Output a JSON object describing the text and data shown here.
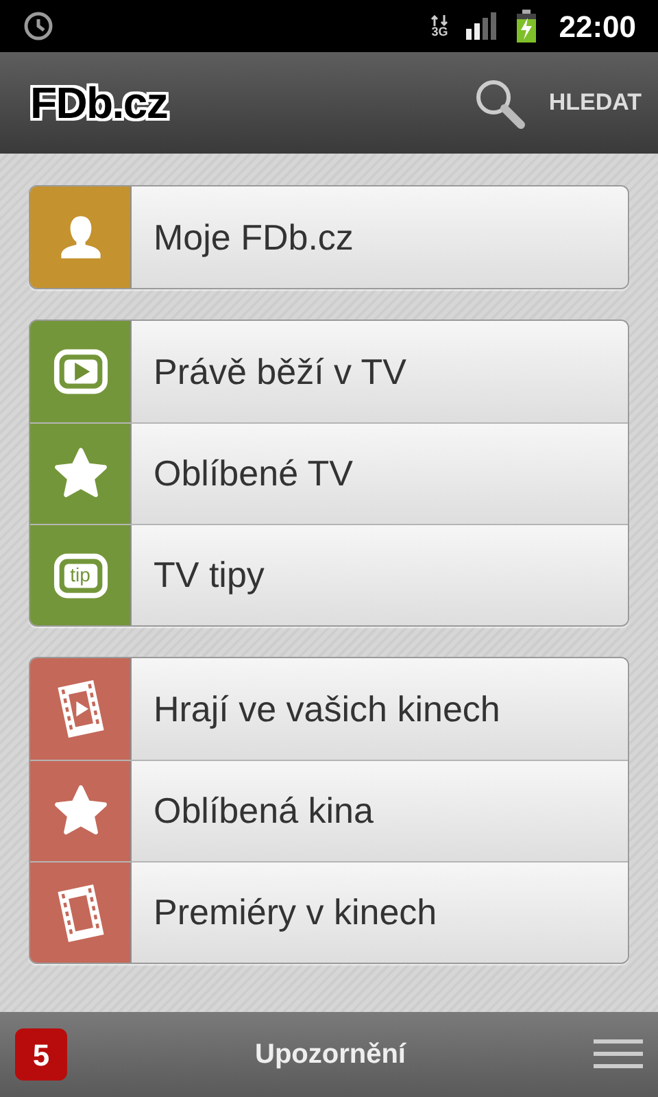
{
  "status_bar": {
    "network": "3G",
    "time": "22:00"
  },
  "app_bar": {
    "logo": "FDb.cz",
    "search_label": "HLEDAT"
  },
  "groups": [
    {
      "color": "#c4922f",
      "items": [
        {
          "kind": "person",
          "label": "Moje FDb.cz"
        }
      ]
    },
    {
      "color": "#74963a",
      "items": [
        {
          "kind": "play",
          "label": "Právě běží v TV"
        },
        {
          "kind": "star",
          "label": "Oblíbené TV"
        },
        {
          "kind": "tip",
          "label": "TV tipy",
          "icon_text": "tip"
        }
      ]
    },
    {
      "color": "#c4685a",
      "items": [
        {
          "kind": "film-play",
          "label": "Hrají ve vašich kinech"
        },
        {
          "kind": "star",
          "label": "Oblíbená kina"
        },
        {
          "kind": "film",
          "label": "Premiéry v kinech"
        }
      ]
    }
  ],
  "bottom_bar": {
    "badge": "5",
    "title": "Upozornění"
  }
}
